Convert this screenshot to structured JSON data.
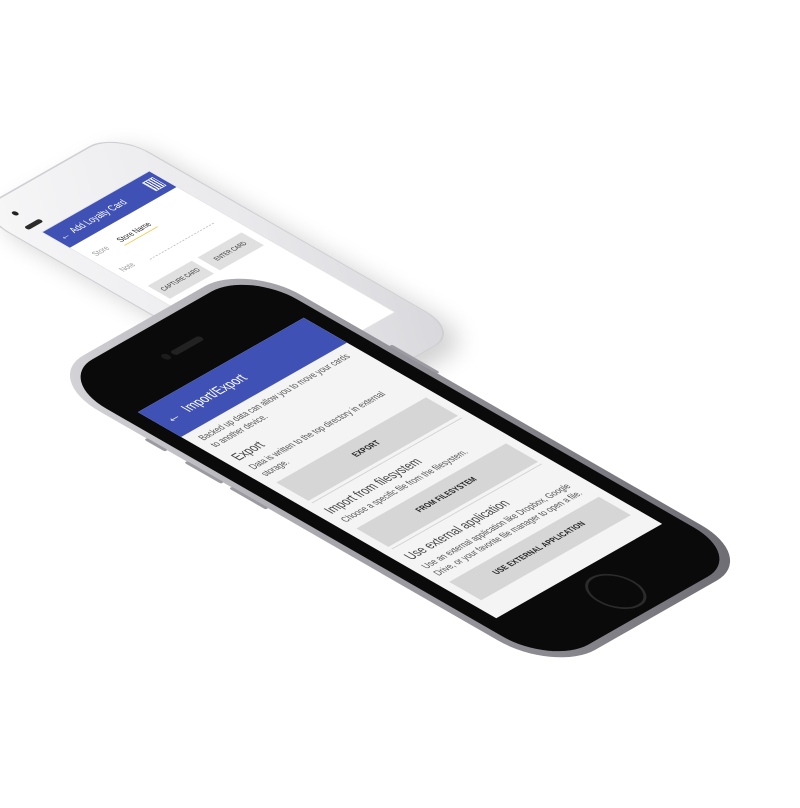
{
  "back_phone": {
    "appbar": {
      "back_icon": "arrow-back-icon",
      "title": "Add Loyalty Card",
      "scan_icon": "barcode-icon"
    },
    "store": {
      "label": "Store",
      "value": "Store Name"
    },
    "note": {
      "label": "Note"
    },
    "buttons": {
      "capture": "CAPTURE CARD",
      "enter": "ENTER CARD"
    }
  },
  "front_phone": {
    "appbar": {
      "back_icon": "arrow-back-icon",
      "title": "Import/Export"
    },
    "intro": "Backed up data can allow you to move your cards to another device.",
    "sections": [
      {
        "title": "Export",
        "description": "Data is written to the top directory in external storage.",
        "button": "EXPORT"
      },
      {
        "title": "Import from filesystem",
        "description": "Choose a specific file from the filesystem.",
        "button": "FROM FILESYSTEM"
      },
      {
        "title": "Use external application",
        "description": "Use an external application like Dropbox, Google Drive, or your favorite file manager to open a file.",
        "button": "USE EXTERNAL APPLICATION"
      }
    ]
  },
  "colors": {
    "primary": "#3f51b5",
    "accent": "#f4c542",
    "button_bg": "#d6d6d6"
  }
}
